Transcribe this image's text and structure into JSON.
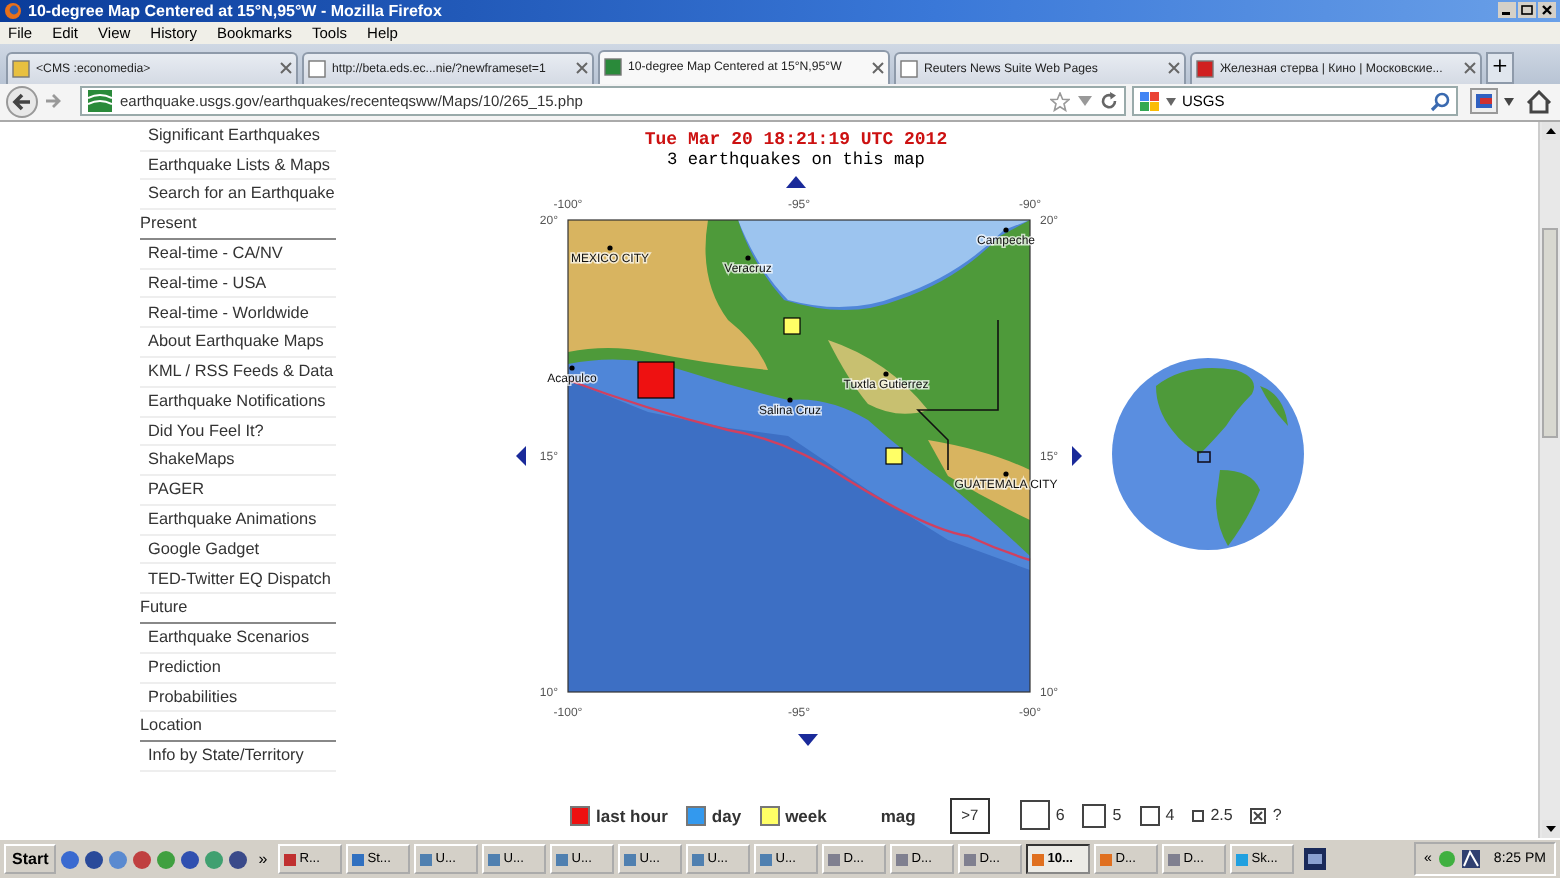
{
  "window": {
    "title": "10-degree Map Centered at 15°N,95°W - Mozilla Firefox"
  },
  "menu": [
    "File",
    "Edit",
    "View",
    "History",
    "Bookmarks",
    "Tools",
    "Help"
  ],
  "tabs": [
    {
      "label": "<CMS :economedia>",
      "selected": false
    },
    {
      "label": "http://beta.eds.ec...nie/?newframeset=1",
      "selected": false
    },
    {
      "label": "10-degree Map Centered at 15°N,95°W",
      "selected": true
    },
    {
      "label": "Reuters News Suite Web Pages",
      "selected": false
    },
    {
      "label": "Железная стерва | Кино | Московские...",
      "selected": false
    }
  ],
  "new_tab": "+",
  "address": {
    "url": "earthquake.usgs.gov/earthquakes/recenteqsww/Maps/10/265_15.php"
  },
  "search": {
    "value": "USGS"
  },
  "sidebar": {
    "items": [
      {
        "label": "Significant Earthquakes",
        "kind": "link"
      },
      {
        "label": "Earthquake Lists & Maps",
        "kind": "link"
      },
      {
        "label": "Search for an Earthquake",
        "kind": "link"
      },
      {
        "label": "Present",
        "kind": "heading"
      },
      {
        "label": "Real-time - CA/NV",
        "kind": "link"
      },
      {
        "label": "Real-time - USA",
        "kind": "link"
      },
      {
        "label": "Real-time - Worldwide",
        "kind": "link"
      },
      {
        "label": "About Earthquake Maps",
        "kind": "link"
      },
      {
        "label": "KML / RSS Feeds & Data",
        "kind": "link"
      },
      {
        "label": "Earthquake Notifications",
        "kind": "link"
      },
      {
        "label": "Did You Feel It?",
        "kind": "link"
      },
      {
        "label": "ShakeMaps",
        "kind": "link"
      },
      {
        "label": "PAGER",
        "kind": "link"
      },
      {
        "label": "Earthquake Animations",
        "kind": "link"
      },
      {
        "label": "Google Gadget",
        "kind": "link"
      },
      {
        "label": "TED-Twitter EQ Dispatch",
        "kind": "link"
      },
      {
        "label": "Future",
        "kind": "heading"
      },
      {
        "label": "Earthquake Scenarios",
        "kind": "link"
      },
      {
        "label": "Prediction",
        "kind": "link"
      },
      {
        "label": "Probabilities",
        "kind": "link"
      },
      {
        "label": "Location",
        "kind": "heading"
      },
      {
        "label": "Info by State/Territory",
        "kind": "link"
      }
    ]
  },
  "map": {
    "title": "Tue Mar 20 18:21:19 UTC 2012",
    "subtitle": "3 earthquakes on this map",
    "top_labels": [
      "-100°",
      "-95°",
      "-90°"
    ],
    "bottom_labels": [
      "-100°",
      "-95°",
      "-90°"
    ],
    "left_labels": [
      "20°",
      "15°",
      "10°"
    ],
    "right_labels": [
      "20°",
      "15°",
      "10°"
    ],
    "cities": [
      "MEXICO CITY",
      "Veracruz",
      "Campeche",
      "Acapulco",
      "Salina Cruz",
      "Tuxtla Gutierrez",
      "GUATEMALA CITY"
    ],
    "earthquakes": [
      {
        "color": "#ee1111"
      },
      {
        "color": "#ffff66"
      },
      {
        "color": "#ffff66"
      }
    ]
  },
  "legend": {
    "ages": [
      {
        "label": "last hour",
        "color": "#ee1111"
      },
      {
        "label": "day",
        "color": "#3399ee"
      },
      {
        "label": "week",
        "color": "#ffff66"
      }
    ],
    "mag_label": "mag",
    "mags": [
      {
        "label": ">7",
        "kind": "inside"
      },
      {
        "label": "6",
        "kind": "box"
      },
      {
        "label": "5",
        "kind": "box"
      },
      {
        "label": "4",
        "kind": "box"
      },
      {
        "label": "2.5",
        "kind": "box"
      },
      {
        "label": "?",
        "kind": "crossed"
      }
    ]
  },
  "taskbar": {
    "start": "Start",
    "chevron": "»",
    "buttons": [
      {
        "label": "R...",
        "selected": false
      },
      {
        "label": "St...",
        "selected": false
      },
      {
        "label": "U...",
        "selected": false
      },
      {
        "label": "U...",
        "selected": false
      },
      {
        "label": "U...",
        "selected": false
      },
      {
        "label": "U...",
        "selected": false
      },
      {
        "label": "U...",
        "selected": false
      },
      {
        "label": "U...",
        "selected": false
      },
      {
        "label": "D...",
        "selected": false
      },
      {
        "label": "D...",
        "selected": false
      },
      {
        "label": "D...",
        "selected": false
      },
      {
        "label": "10...",
        "selected": true
      },
      {
        "label": "D...",
        "selected": false
      },
      {
        "label": "D...",
        "selected": false
      },
      {
        "label": "Sk...",
        "selected": false
      }
    ],
    "tray_toggle": "«",
    "clock": "8:25 PM"
  }
}
